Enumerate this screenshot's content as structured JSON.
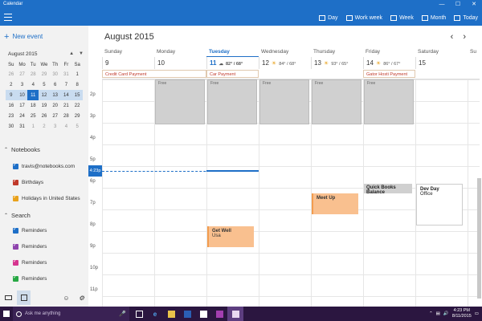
{
  "window": {
    "title": "Calendar",
    "controls": [
      "—",
      "☐",
      "✕"
    ]
  },
  "toolbar": {
    "views": [
      {
        "label": "Day",
        "icon": "day-view-icon"
      },
      {
        "label": "Work week",
        "icon": "work-week-view-icon"
      },
      {
        "label": "Week",
        "icon": "week-view-icon"
      },
      {
        "label": "Month",
        "icon": "month-view-icon"
      },
      {
        "label": "Today",
        "icon": "today-icon"
      }
    ]
  },
  "sidebar": {
    "new_event": "New event",
    "mini_calendar": {
      "title": "August 2015",
      "weekdays": [
        "Su",
        "Mo",
        "Tu",
        "We",
        "Th",
        "Fr",
        "Sa"
      ],
      "weeks": [
        [
          "26",
          "27",
          "28",
          "29",
          "30",
          "31",
          "1"
        ],
        [
          "2",
          "3",
          "4",
          "5",
          "6",
          "7",
          "8"
        ],
        [
          "9",
          "10",
          "11",
          "12",
          "13",
          "14",
          "15"
        ],
        [
          "16",
          "17",
          "18",
          "19",
          "20",
          "21",
          "22"
        ],
        [
          "23",
          "24",
          "25",
          "26",
          "27",
          "28",
          "29"
        ],
        [
          "30",
          "31",
          "1",
          "2",
          "3",
          "4",
          "5"
        ]
      ]
    },
    "notebooks_header": "Notebooks",
    "notebooks": [
      {
        "label": "travis@notebooks.com",
        "color": "#1e6fc7"
      },
      {
        "label": "Birthdays",
        "color": "#c0392b"
      },
      {
        "label": "Holidays in United States",
        "color": "#e9a21c"
      }
    ],
    "search_header": "Search",
    "search_items": [
      {
        "label": "Reminders",
        "color": "#1e6fc7"
      },
      {
        "label": "Reminders",
        "color": "#8e44ad"
      },
      {
        "label": "Reminders",
        "color": "#d6358f"
      },
      {
        "label": "Reminders",
        "color": "#27a844"
      }
    ]
  },
  "main": {
    "month_title": "August 2015",
    "days": [
      {
        "name": "Sunday",
        "date": "9",
        "weather": "",
        "temp": ""
      },
      {
        "name": "Monday",
        "date": "10",
        "weather": "",
        "temp": ""
      },
      {
        "name": "Tuesday",
        "date": "11",
        "weather": "cloud",
        "temp": "82° / 68°"
      },
      {
        "name": "Wednesday",
        "date": "12",
        "weather": "sun",
        "temp": "84° / 68°"
      },
      {
        "name": "Thursday",
        "date": "13",
        "weather": "sun",
        "temp": "93° / 65°"
      },
      {
        "name": "Friday",
        "date": "14",
        "weather": "sun",
        "temp": "86° / 67°"
      },
      {
        "name": "Saturday",
        "date": "15",
        "weather": "",
        "temp": ""
      },
      {
        "name": "Su",
        "date": "",
        "weather": "",
        "temp": ""
      }
    ],
    "allday_events": [
      "Credit Card Payment",
      "Car Payment",
      "Gator Hosti Payment"
    ],
    "busy_label": "Free",
    "times": [
      "2p",
      "3p",
      "4p",
      "5p",
      "6p",
      "7p",
      "8p",
      "9p",
      "10p",
      "11p"
    ],
    "current_time": "4:23p",
    "events": [
      {
        "title": "Get Well",
        "sub": "Usa"
      },
      {
        "title": "Meet Up",
        "sub": ""
      },
      {
        "title": "Quick Books Balance",
        "sub": ""
      },
      {
        "title": "Dev Day",
        "sub": "Office"
      }
    ]
  },
  "taskbar": {
    "search_placeholder": "Ask me anything",
    "time": "4:23 PM",
    "date": "8/11/2015"
  }
}
